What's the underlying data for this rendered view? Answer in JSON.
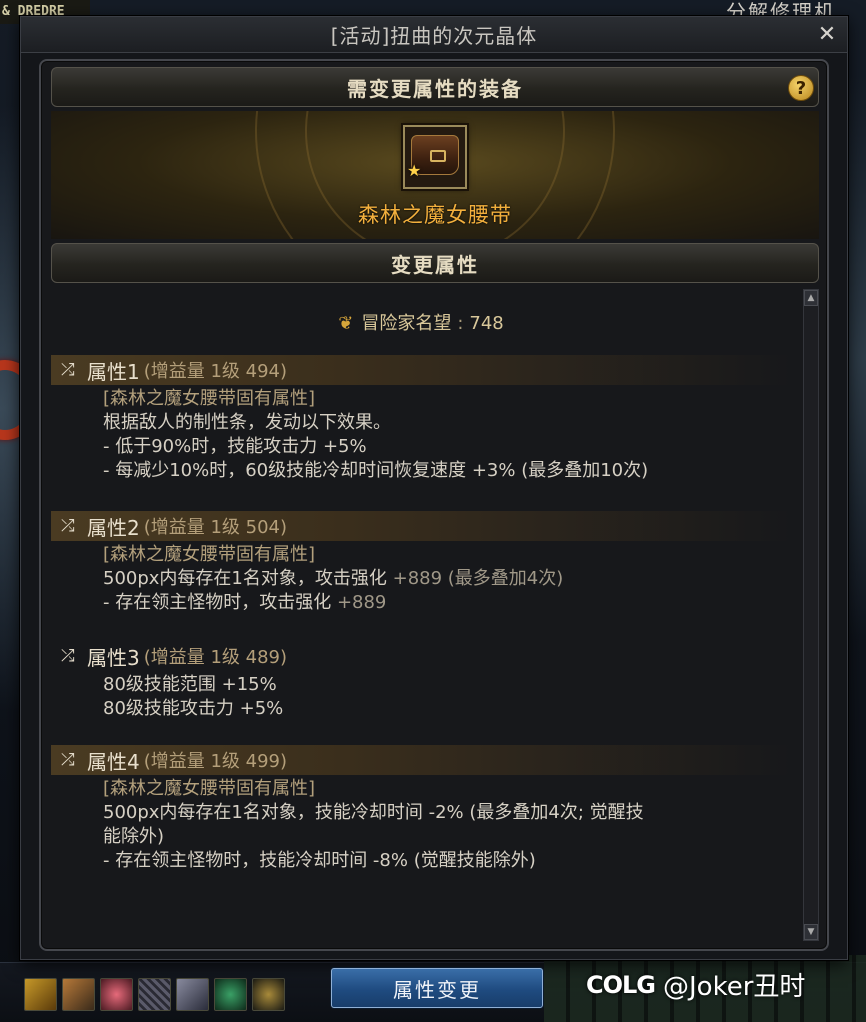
{
  "background": {
    "top_left_text": "& DREDRE",
    "top_right_text": "分解修理机"
  },
  "dialog": {
    "title": "[活动]扭曲的次元晶体",
    "close_icon": "close-icon"
  },
  "equipment_section": {
    "header": "需变更属性的装备",
    "help_label": "?",
    "item_name": "森林之魔女腰带",
    "item_icon": "belt-icon"
  },
  "change_section": {
    "header": "变更属性",
    "fame_label": "冒险家名望",
    "fame_separator": ":",
    "fame_value": "748"
  },
  "attributes": [
    {
      "title": "属性1",
      "meta": "(增益量 1级 494)",
      "highlighted": true,
      "lines": [
        {
          "text": "[森林之魔女腰带固有属性]",
          "inherent": true
        },
        {
          "text": "根据敌人的制性条，发动以下效果。"
        },
        {
          "text": "- 低于90%时，技能攻击力 +5%"
        },
        {
          "text": "- 每减少10%时，60级技能冷却时间恢复速度 +3% (最多叠加10次)"
        }
      ]
    },
    {
      "title": "属性2",
      "meta": "(增益量 1级 504)",
      "highlighted": true,
      "lines": [
        {
          "text": "[森林之魔女腰带固有属性]",
          "inherent": true
        },
        {
          "text": "500px内每存在1名对象，攻击强化 ",
          "dim": "+889 (最多叠加4次)"
        },
        {
          "text": "- 存在领主怪物时，攻击强化 ",
          "dim": "+889"
        }
      ]
    },
    {
      "title": "属性3",
      "meta": "(增益量 1级 489)",
      "highlighted": false,
      "lines": [
        {
          "text": "80级技能范围 +15%"
        },
        {
          "text": "80级技能攻击力 +5%"
        }
      ]
    },
    {
      "title": "属性4",
      "meta": "(增益量 1级 499)",
      "highlighted": true,
      "lines": [
        {
          "text": "[森林之魔女腰带固有属性]",
          "inherent": true
        },
        {
          "text": "500px内每存在1名对象，技能冷却时间 -2% (最多叠加4次; 觉醒技"
        },
        {
          "text": "能除外)"
        },
        {
          "text": "- 存在领主怪物时，技能冷却时间 -8% (觉醒技能除外)"
        }
      ]
    }
  ],
  "button": {
    "change_label": "属性变更"
  },
  "watermark": {
    "logo": "COLG",
    "handle": "@Joker丑时"
  },
  "colors": {
    "item_name": "#f3b03d",
    "inherent_text": "#b3a07c",
    "button_blue": "#1f4b80",
    "header_text": "#e6dcc2"
  }
}
